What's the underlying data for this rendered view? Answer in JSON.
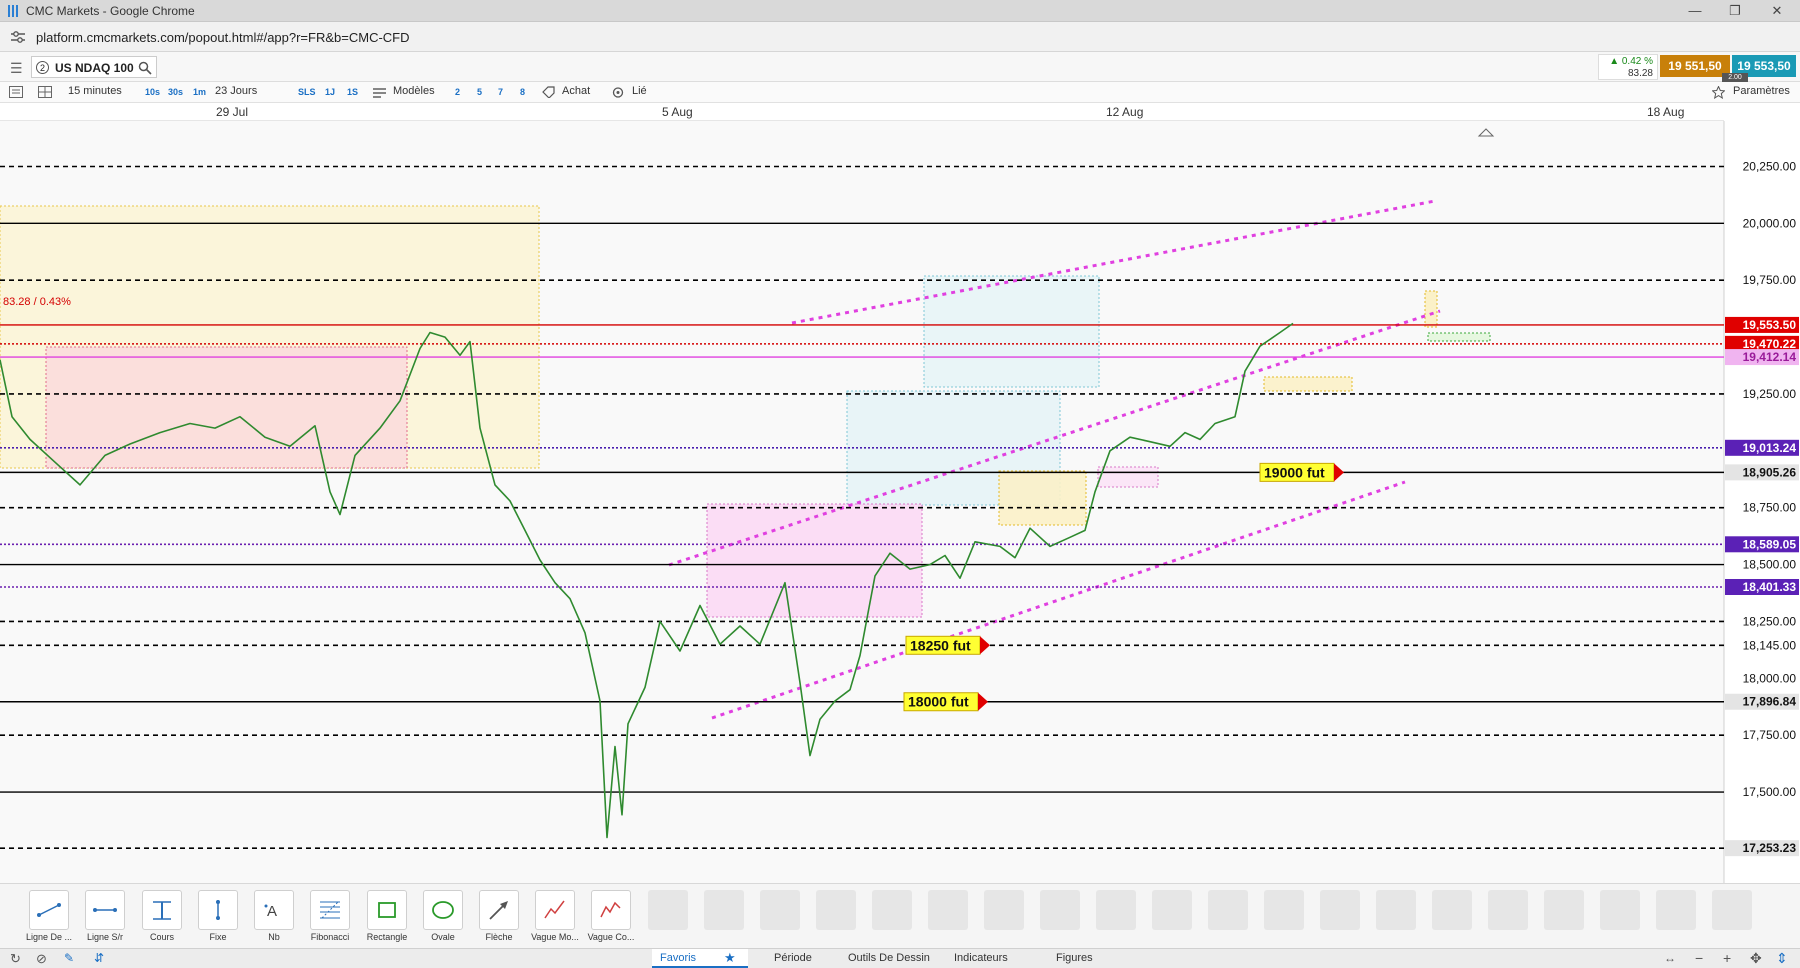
{
  "window": {
    "title": "CMC Markets - Google Chrome"
  },
  "browser": {
    "url": "platform.cmcmarkets.com/popout.html#/app?r=FR&b=CMC-CFD"
  },
  "instrument": {
    "badge": "2",
    "name": "US NDAQ 100",
    "change_pct": "▲ 0.42 %",
    "change_pts": "83.28",
    "bid": "19 551,50",
    "ask": "19 553,50",
    "spread": "2.00"
  },
  "toolbar": {
    "interval": "15 minutes",
    "intervals": [
      "10s",
      "30s",
      "1m"
    ],
    "range": "23 Jours",
    "quick_ranges": [
      "SLS",
      "1J",
      "1S"
    ],
    "templates": "Modèles",
    "counts": [
      "2",
      "5",
      "7",
      "8"
    ],
    "buy": "Achat",
    "linked": "Lié",
    "settings": "Paramètres"
  },
  "dates": [
    "29 Jul",
    "5 Aug",
    "12 Aug",
    "18 Aug"
  ],
  "chart_data": {
    "type": "line",
    "instrument": "US NDAQ 100",
    "interval": "15 minutes",
    "change_label": "83.28 / 0.43%",
    "current_price": 19553.5,
    "ylim": [
      17100,
      20450
    ],
    "x_ticks": [
      "29 Jul",
      "5 Aug",
      "12 Aug",
      "18 Aug"
    ],
    "price_path": [
      [
        0,
        19400
      ],
      [
        12,
        19150
      ],
      [
        30,
        19050
      ],
      [
        55,
        18950
      ],
      [
        80,
        18850
      ],
      [
        105,
        18980
      ],
      [
        130,
        19030
      ],
      [
        160,
        19080
      ],
      [
        190,
        19120
      ],
      [
        215,
        19100
      ],
      [
        240,
        19150
      ],
      [
        265,
        19060
      ],
      [
        290,
        19020
      ],
      [
        315,
        19110
      ],
      [
        330,
        18820
      ],
      [
        340,
        18720
      ],
      [
        355,
        18980
      ],
      [
        380,
        19100
      ],
      [
        400,
        19220
      ],
      [
        420,
        19450
      ],
      [
        430,
        19520
      ],
      [
        445,
        19500
      ],
      [
        460,
        19420
      ],
      [
        470,
        19480
      ],
      [
        480,
        19100
      ],
      [
        495,
        18850
      ],
      [
        510,
        18780
      ],
      [
        525,
        18650
      ],
      [
        540,
        18520
      ],
      [
        555,
        18420
      ],
      [
        570,
        18350
      ],
      [
        585,
        18200
      ],
      [
        600,
        17900
      ],
      [
        607,
        17300
      ],
      [
        615,
        17700
      ],
      [
        622,
        17400
      ],
      [
        628,
        17800
      ],
      [
        645,
        17960
      ],
      [
        660,
        18250
      ],
      [
        680,
        18120
      ],
      [
        700,
        18320
      ],
      [
        720,
        18150
      ],
      [
        740,
        18230
      ],
      [
        760,
        18150
      ],
      [
        785,
        18420
      ],
      [
        800,
        17980
      ],
      [
        810,
        17660
      ],
      [
        820,
        17820
      ],
      [
        835,
        17900
      ],
      [
        850,
        17950
      ],
      [
        860,
        18100
      ],
      [
        875,
        18450
      ],
      [
        890,
        18550
      ],
      [
        910,
        18480
      ],
      [
        930,
        18500
      ],
      [
        945,
        18540
      ],
      [
        960,
        18440
      ],
      [
        975,
        18600
      ],
      [
        1000,
        18580
      ],
      [
        1015,
        18530
      ],
      [
        1030,
        18660
      ],
      [
        1050,
        18580
      ],
      [
        1070,
        18620
      ],
      [
        1085,
        18650
      ],
      [
        1095,
        18820
      ],
      [
        1110,
        19000
      ],
      [
        1130,
        19060
      ],
      [
        1150,
        19040
      ],
      [
        1170,
        19020
      ],
      [
        1185,
        19080
      ],
      [
        1200,
        19050
      ],
      [
        1215,
        19120
      ],
      [
        1235,
        19150
      ],
      [
        1245,
        19350
      ],
      [
        1260,
        19460
      ],
      [
        1280,
        19520
      ],
      [
        1293,
        19560
      ]
    ],
    "price_levels": [
      {
        "value": 20250.0,
        "label": "20,250.00",
        "style": "dashed",
        "color": "#000000",
        "box": "plain"
      },
      {
        "value": 20000.0,
        "label": "20,000.00",
        "style": "solid",
        "color": "#000000",
        "box": "plain"
      },
      {
        "value": 19750.0,
        "label": "19,750.00",
        "style": "dashed",
        "color": "#000000",
        "box": "plain"
      },
      {
        "value": 19553.5,
        "label": "19,553.50",
        "style": "solid",
        "color": "#d40000",
        "box": "red"
      },
      {
        "value": 19470.22,
        "label": "19,470.22",
        "style": "dotted",
        "color": "#d40000",
        "box": "red"
      },
      {
        "value": 19412.14,
        "label": "19,412.14",
        "style": "solid",
        "color": "#e040e0",
        "box": "magenta"
      },
      {
        "value": 19250.0,
        "label": "19,250.00",
        "style": "dashed",
        "color": "#000000",
        "box": "plain"
      },
      {
        "value": 19013.24,
        "label": "19,013.24",
        "style": "dotted",
        "color": "#4a1fb0",
        "box": "purple"
      },
      {
        "value": 18905.26,
        "label": "18,905.26",
        "style": "solid",
        "color": "#000000",
        "box": "grey"
      },
      {
        "value": 18750.0,
        "label": "18,750.00",
        "style": "dashed",
        "color": "#000000",
        "box": "plain"
      },
      {
        "value": 18589.05,
        "label": "18,589.05",
        "style": "dotted",
        "color": "#6a1fb0",
        "box": "purple"
      },
      {
        "value": 18500.0,
        "label": "18,500.00",
        "style": "solid",
        "color": "#000000",
        "box": "plain"
      },
      {
        "value": 18401.33,
        "label": "18,401.33",
        "style": "dotted",
        "color": "#6a1fb0",
        "box": "purple"
      },
      {
        "value": 18250.0,
        "label": "18,250.00",
        "style": "dashed",
        "color": "#000000",
        "box": "plain"
      },
      {
        "value": 18145.0,
        "label": "18,145.00",
        "style": "dashed",
        "color": "#000000",
        "box": "plain"
      },
      {
        "value": 18000.0,
        "label": "18,000.00",
        "style": "none",
        "color": "#000000",
        "box": "plain"
      },
      {
        "value": 17896.84,
        "label": "17,896.84",
        "style": "solid",
        "color": "#000000",
        "box": "grey"
      },
      {
        "value": 17750.0,
        "label": "17,750.00",
        "style": "dashed",
        "color": "#000000",
        "box": "plain"
      },
      {
        "value": 17500.0,
        "label": "17,500.00",
        "style": "solid",
        "color": "#000000",
        "box": "plain"
      },
      {
        "value": 17253.23,
        "label": "17,253.23",
        "style": "dashed",
        "color": "#000000",
        "box": "grey"
      }
    ],
    "annotations": [
      {
        "text": "19000 fut",
        "value": 18905.26
      },
      {
        "text": "18250 fut",
        "value": 18145.0
      },
      {
        "text": "18000 fut",
        "value": 17896.84
      }
    ]
  },
  "drawing_tools": [
    {
      "label": "Ligne De ...",
      "icon": "line-tool-icon"
    },
    {
      "label": "Ligne S/r",
      "icon": "support-line-icon"
    },
    {
      "label": "Cours",
      "icon": "price-tool-icon"
    },
    {
      "label": "Fixe",
      "icon": "fixed-tool-icon"
    },
    {
      "label": "Nb",
      "icon": "text-note-icon"
    },
    {
      "label": "Fibonacci",
      "icon": "fibonacci-icon"
    },
    {
      "label": "Rectangle",
      "icon": "rectangle-icon"
    },
    {
      "label": "Ovale",
      "icon": "oval-icon"
    },
    {
      "label": "Flèche",
      "icon": "arrow-icon"
    },
    {
      "label": "Vague Mo...",
      "icon": "wave-motive-icon"
    },
    {
      "label": "Vague Co...",
      "icon": "wave-corrective-icon"
    }
  ],
  "bottom_tabs": [
    "Favoris",
    "Période",
    "Outils De Dessin",
    "Indicateurs",
    "Figures"
  ]
}
